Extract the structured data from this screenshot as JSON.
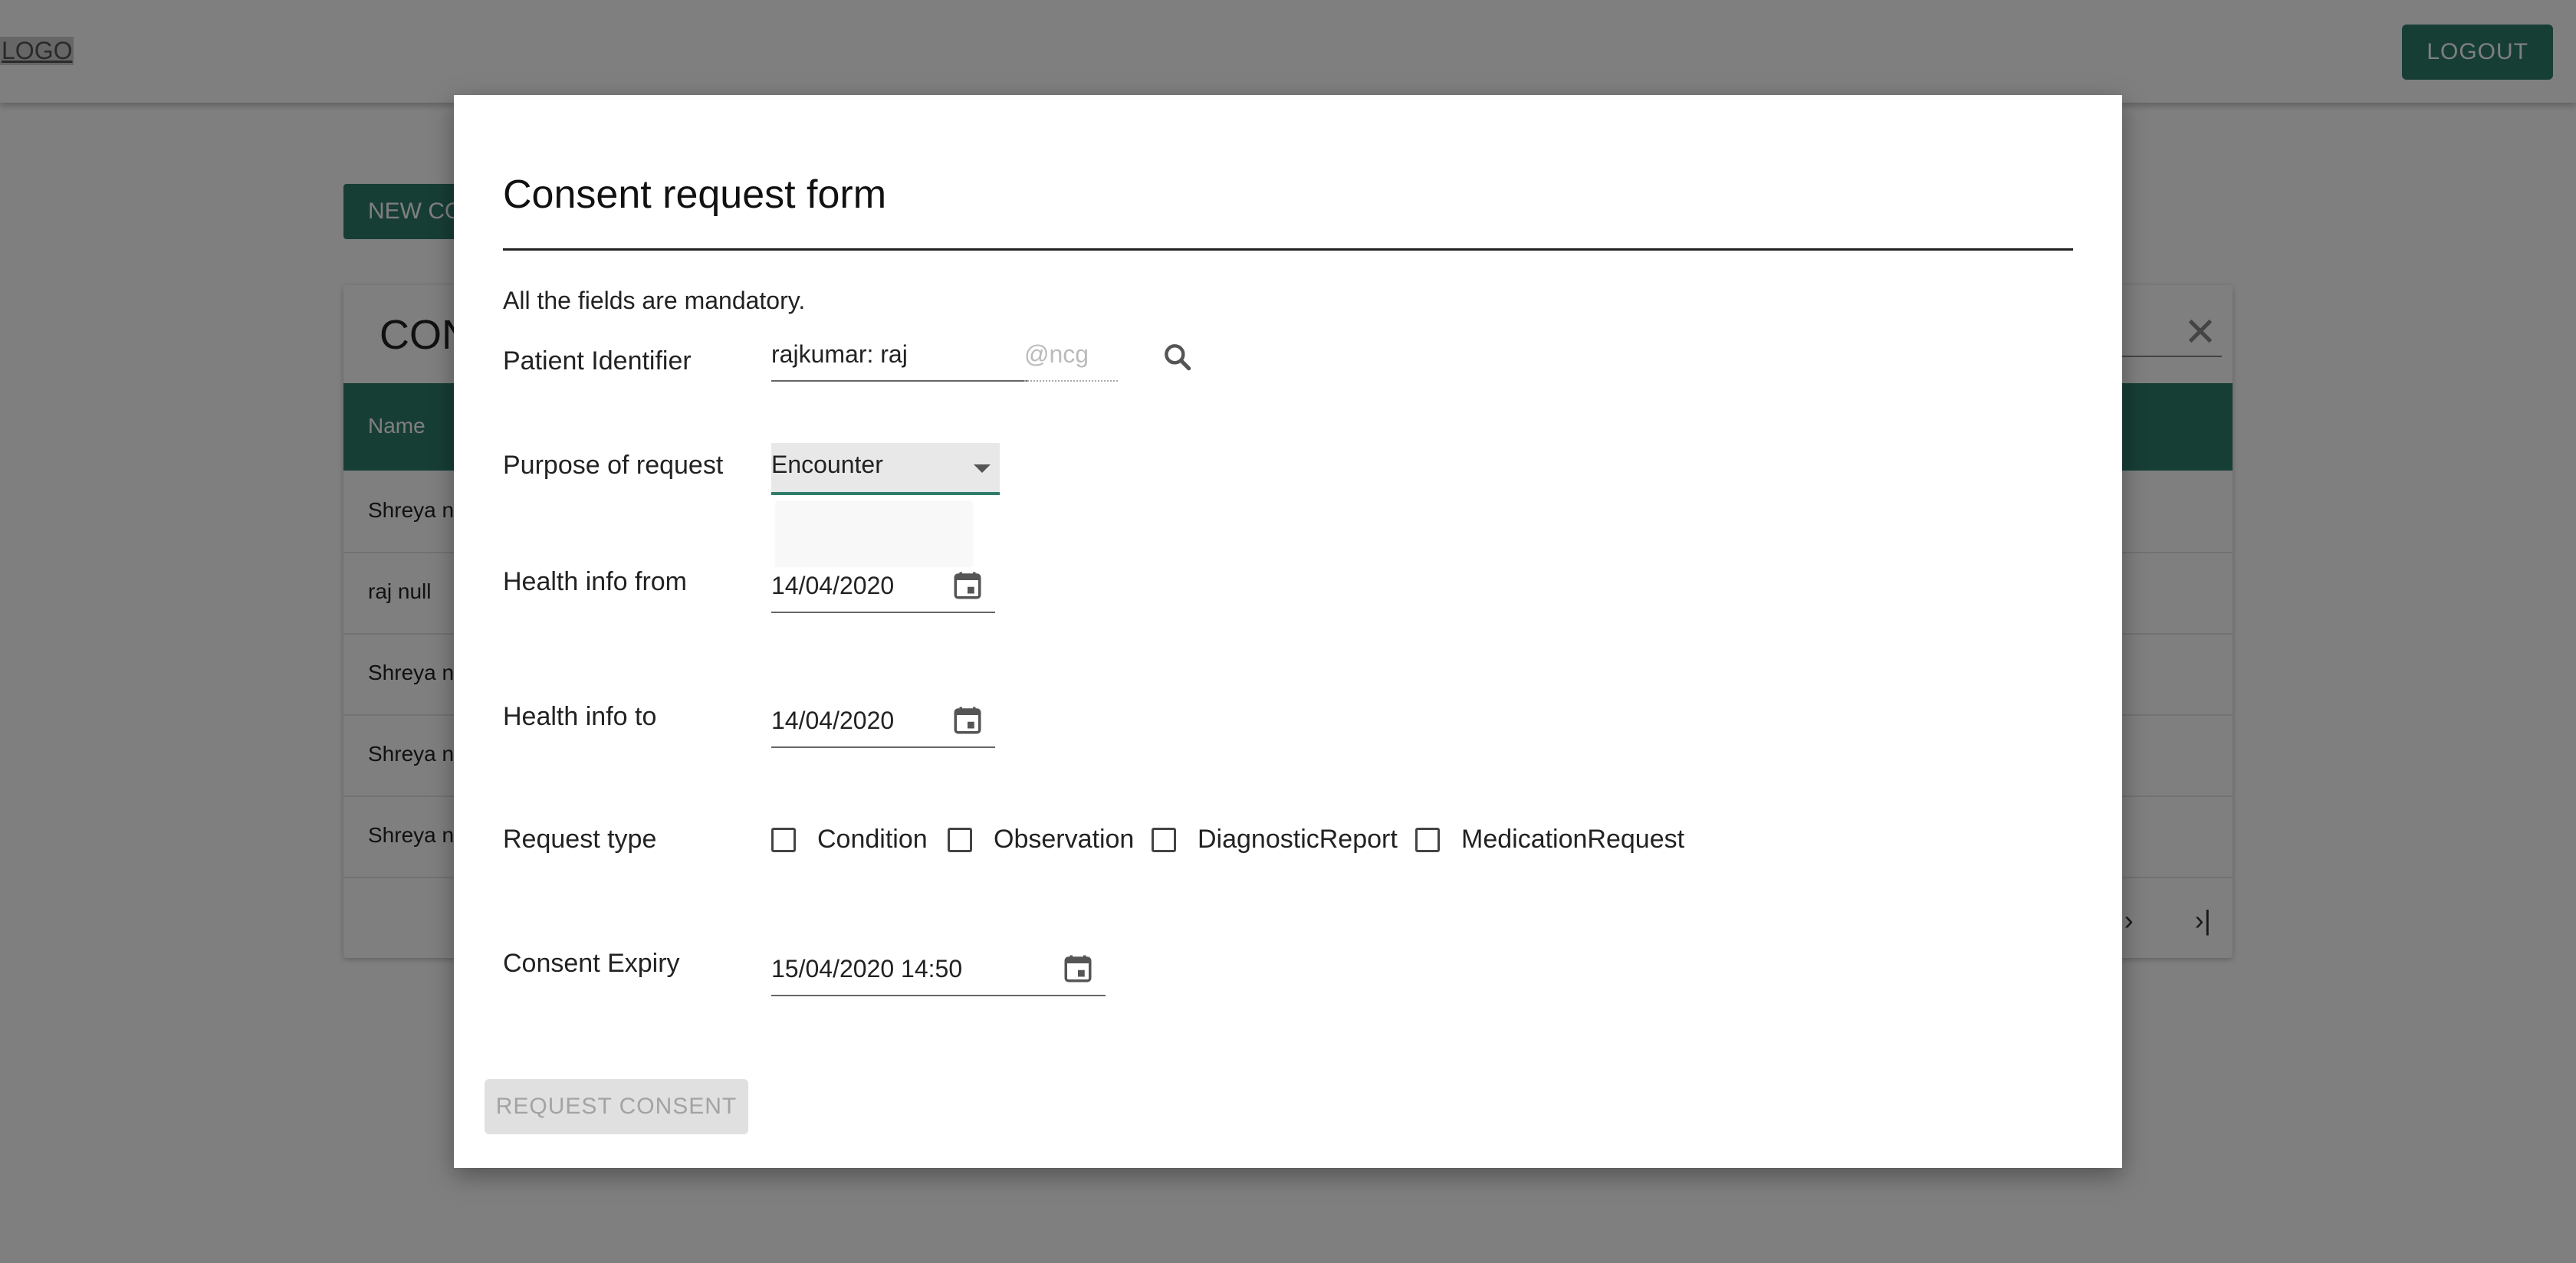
{
  "header": {
    "logo_text": "LOGO",
    "logout_label": "LOGOUT"
  },
  "background": {
    "new_button_label": "NEW CONSENT REQUEST",
    "card_title": "CONSENT REQUESTS",
    "table": {
      "header_name": "Name",
      "rows": [
        "Shreya null",
        "raj null",
        "Shreya null",
        "Shreya null",
        "Shreya null"
      ]
    },
    "pager_next": "›",
    "pager_last": "›|"
  },
  "modal": {
    "title": "Consent request form",
    "mandatory_note": "All the fields are mandatory.",
    "patient_identifier": {
      "label": "Patient Identifier",
      "value": "rajkumar: raj",
      "suffix": "@ncg"
    },
    "purpose": {
      "label": "Purpose of request",
      "value": "Encounter"
    },
    "health_from": {
      "label": "Health info from",
      "value": "14/04/2020"
    },
    "health_to": {
      "label": "Health info to",
      "value": "14/04/2020"
    },
    "request_type": {
      "label": "Request type",
      "options": [
        "Condition",
        "Observation",
        "DiagnosticReport",
        "MedicationRequest"
      ]
    },
    "expiry": {
      "label": "Consent Expiry",
      "value": "15/04/2020 14:50"
    },
    "submit_label": "REQUEST CONSENT"
  },
  "colors": {
    "accent": "#2e7d6b",
    "overlay": "rgba(0,0,0,0.5)"
  },
  "icons": [
    "search-icon",
    "calendar-icon",
    "close-icon",
    "dropdown-caret-icon"
  ]
}
